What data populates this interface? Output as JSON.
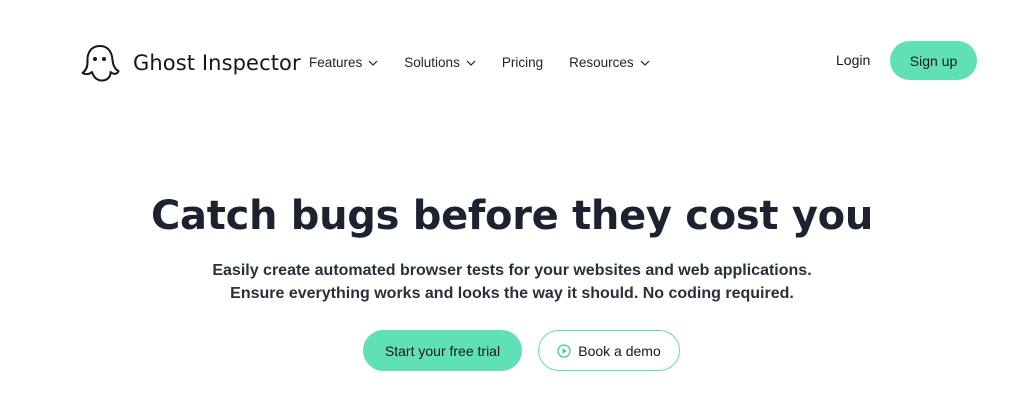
{
  "header": {
    "logo_text": "Ghost Inspector",
    "nav": [
      {
        "label": "Features",
        "has_dropdown": true
      },
      {
        "label": "Solutions",
        "has_dropdown": true
      },
      {
        "label": "Pricing",
        "has_dropdown": false
      },
      {
        "label": "Resources",
        "has_dropdown": true
      }
    ],
    "login_label": "Login",
    "signup_label": "Sign up"
  },
  "hero": {
    "title": "Catch bugs before they cost you",
    "subtitle_line1": "Easily create automated browser tests for your websites and web applications.",
    "subtitle_line2": "Ensure everything works and looks the way it should. No coding required.",
    "primary_cta": "Start your free trial",
    "secondary_cta": "Book a demo"
  },
  "icons": {
    "logo": "ghost-icon",
    "dropdown": "chevron-down-icon",
    "demo": "play-circle-icon"
  },
  "colors": {
    "accent": "#5fe0b7",
    "text": "#1d2230",
    "background": "#ffffff"
  }
}
